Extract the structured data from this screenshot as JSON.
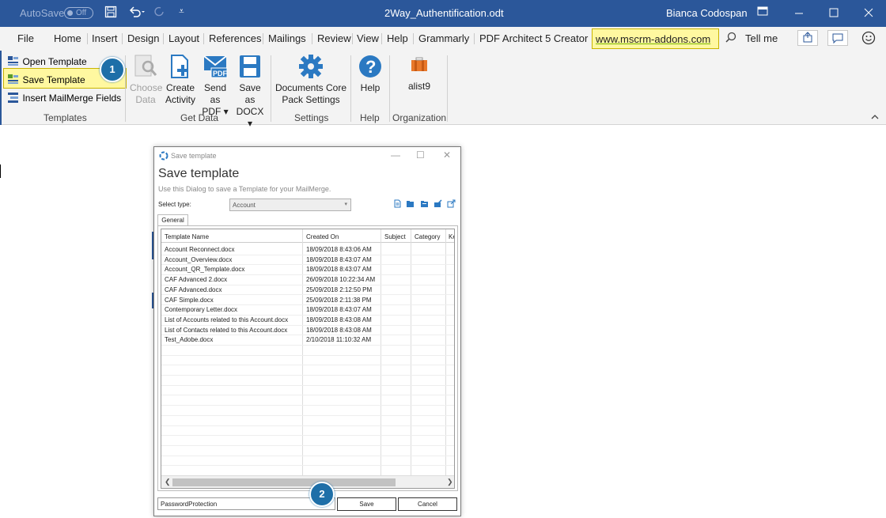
{
  "titlebar": {
    "autosave_label": "AutoSave",
    "autosave_state": "Off",
    "document_title": "2Way_Authentification.odt",
    "user": "Bianca Codospan",
    "bg_color": "#2b579a"
  },
  "menu": {
    "items": [
      "File",
      "Home",
      "Insert",
      "Design",
      "Layout",
      "References",
      "Mailings",
      "Review",
      "View",
      "Help",
      "Grammarly",
      "PDF Architect 5 Creator"
    ],
    "link": "www.mscrm-addons.com",
    "tell_me": "Tell me"
  },
  "ribbon": {
    "templates": {
      "open_template": "Open Template",
      "save_template": "Save Template",
      "insert_fields": "Insert MailMerge Fields",
      "group_label": "Templates"
    },
    "get_data": {
      "choose_data_1": "Choose",
      "choose_data_2": "Data",
      "create_activity_1": "Create",
      "create_activity_2": "Activity",
      "send_pdf_1": "Send as",
      "send_pdf_2": "PDF ▾",
      "save_docx_1": "Save as",
      "save_docx_2": "DOCX ▾",
      "group_label": "Get Data"
    },
    "settings": {
      "label_1": "Documents Core",
      "label_2": "Pack Settings",
      "group_label": "Settings"
    },
    "help": {
      "label": "Help",
      "group_label": "Help"
    },
    "organization": {
      "label": "alist9",
      "group_label": "Organization"
    }
  },
  "callouts": {
    "one": "1",
    "two": "2"
  },
  "dialog": {
    "window_title": "Save template",
    "heading": "Save template",
    "subtitle": "Use this Dialog to save a Template for your MailMerge.",
    "select_type_label": "Select type:",
    "select_type_value": "Account",
    "tab": "General",
    "columns": [
      "Template Name",
      "Created On",
      "Subject",
      "Category",
      "Ke"
    ],
    "rows": [
      {
        "name": "Account Reconnect.docx",
        "created": "18/09/2018 8:43:06 AM"
      },
      {
        "name": "Account_Overview.docx",
        "created": "18/09/2018 8:43:07 AM"
      },
      {
        "name": "Account_QR_Template.docx",
        "created": "18/09/2018 8:43:07 AM"
      },
      {
        "name": "CAF Advanced 2.docx",
        "created": "26/09/2018 10:22:34 AM"
      },
      {
        "name": "CAF Advanced.docx",
        "created": "25/09/2018 2:12:50 PM"
      },
      {
        "name": "CAF Simple.docx",
        "created": "25/09/2018 2:11:38 PM"
      },
      {
        "name": "Contemporary Letter.docx",
        "created": "18/09/2018 8:43:07 AM"
      },
      {
        "name": "List of Accounts related to this Account.docx",
        "created": "18/09/2018 8:43:08 AM"
      },
      {
        "name": "List of Contacts related to this Account.docx",
        "created": "18/09/2018 8:43:08 AM"
      },
      {
        "name": "Test_Adobe.docx",
        "created": "2/10/2018 11:10:32 AM"
      }
    ],
    "name_value": "PasswordProtection",
    "save_label": "Save",
    "cancel_label": "Cancel"
  }
}
